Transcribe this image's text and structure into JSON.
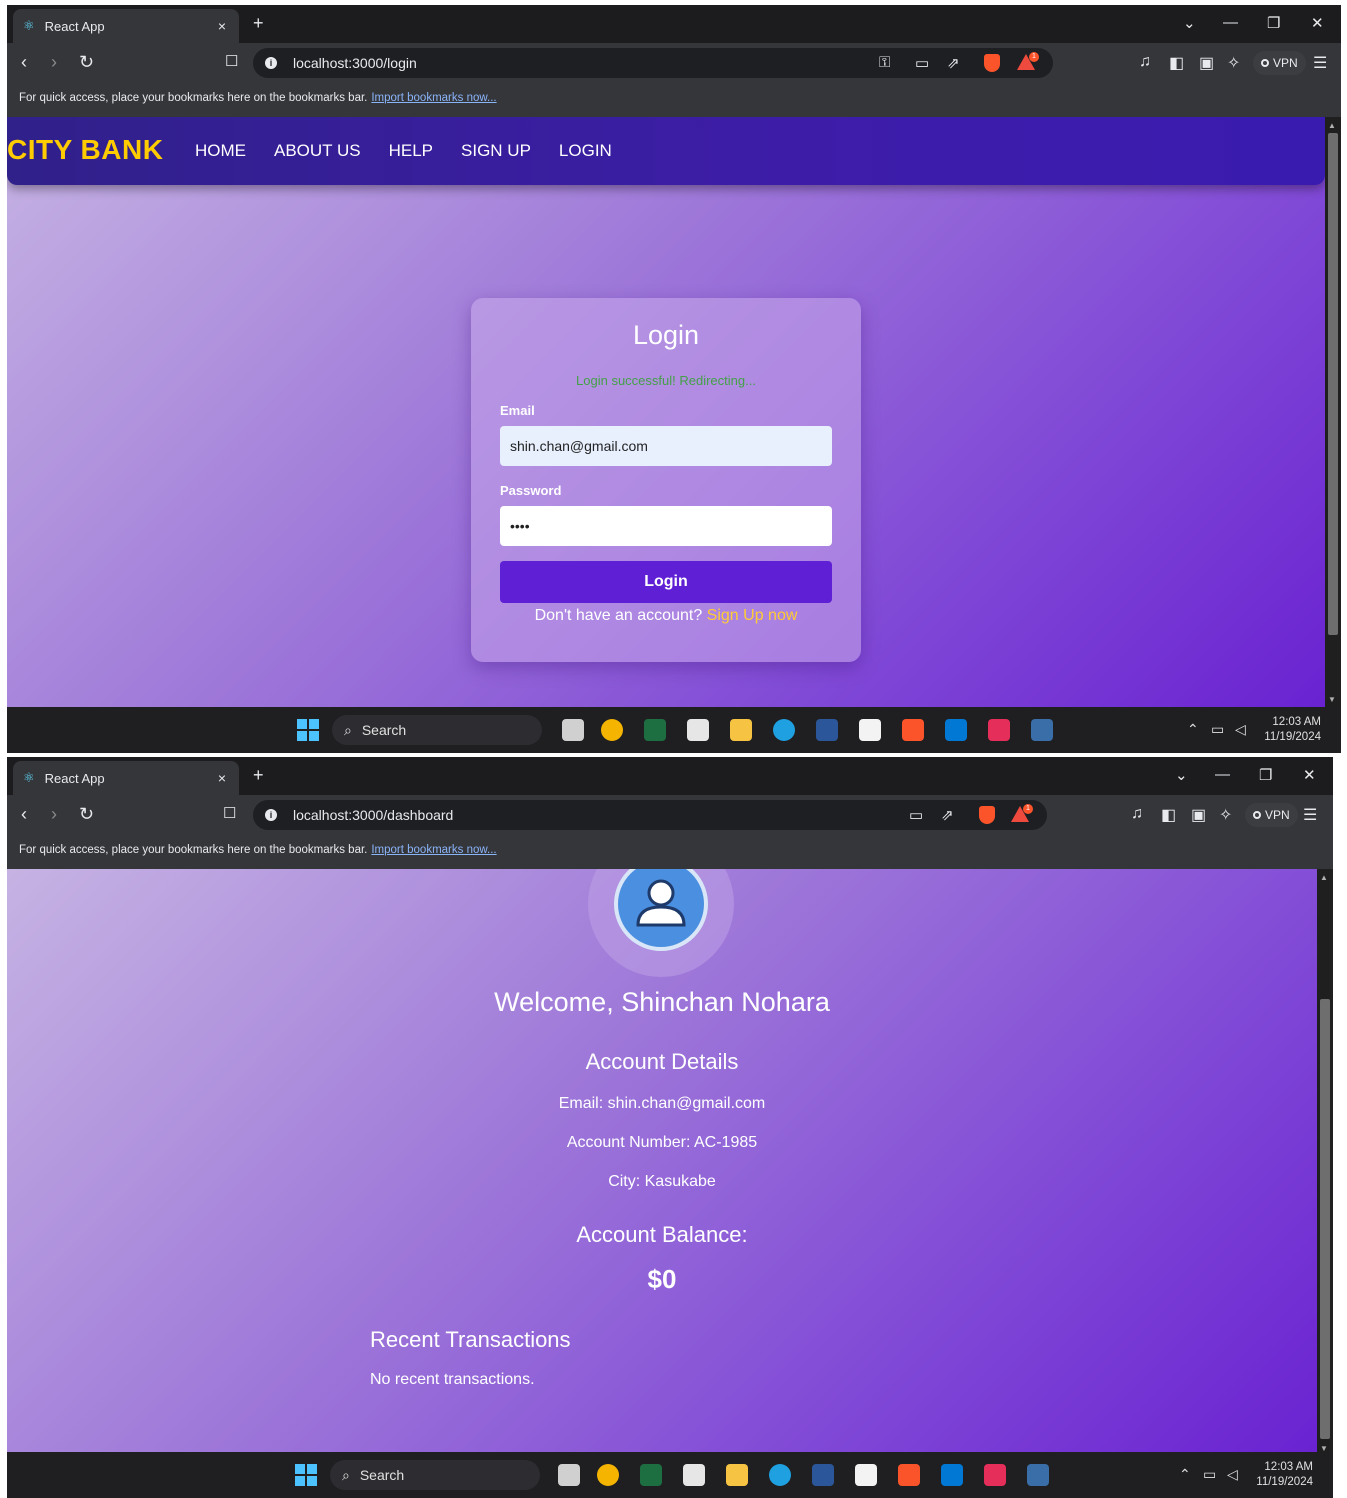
{
  "browser": {
    "tab_title": "React App",
    "tab_close": "×",
    "new_tab": "+",
    "bookmarks_text": "For quick access, place your bookmarks here on the bookmarks bar.",
    "bookmarks_link": "Import bookmarks now...",
    "vpn_label": "VPN"
  },
  "login_page": {
    "url": "localhost:3000/login",
    "brand": "CITY BANK",
    "nav": [
      "HOME",
      "ABOUT US",
      "HELP",
      "SIGN UP",
      "LOGIN"
    ],
    "card": {
      "title": "Login",
      "status_message": "Login successful! Redirecting...",
      "email_label": "Email",
      "email_value": "shin.chan@gmail.com",
      "password_label": "Password",
      "password_value": "••••",
      "button_label": "Login",
      "signup_prompt": "Don't have an account?",
      "signup_link": "Sign Up now"
    }
  },
  "dashboard_page": {
    "url": "localhost:3000/dashboard",
    "welcome": "Welcome, Shinchan Nohara",
    "account_heading": "Account Details",
    "email": "Email: shin.chan@gmail.com",
    "account_number": "Account Number: AC-1985",
    "city": "City: Kasukabe",
    "balance_heading": "Account Balance:",
    "balance_value": "$0",
    "transactions_heading": "Recent Transactions",
    "transactions_empty": "No recent transactions."
  },
  "taskbar": {
    "search_label": "Search",
    "time": "12:03 AM",
    "date": "11/19/2024"
  },
  "colors": {
    "brand_yellow": "#ffcc00",
    "navbar": "#3d1da8",
    "login_button": "#5f1fd4",
    "success_green": "#43a047",
    "signup_link": "#ffcc33"
  }
}
